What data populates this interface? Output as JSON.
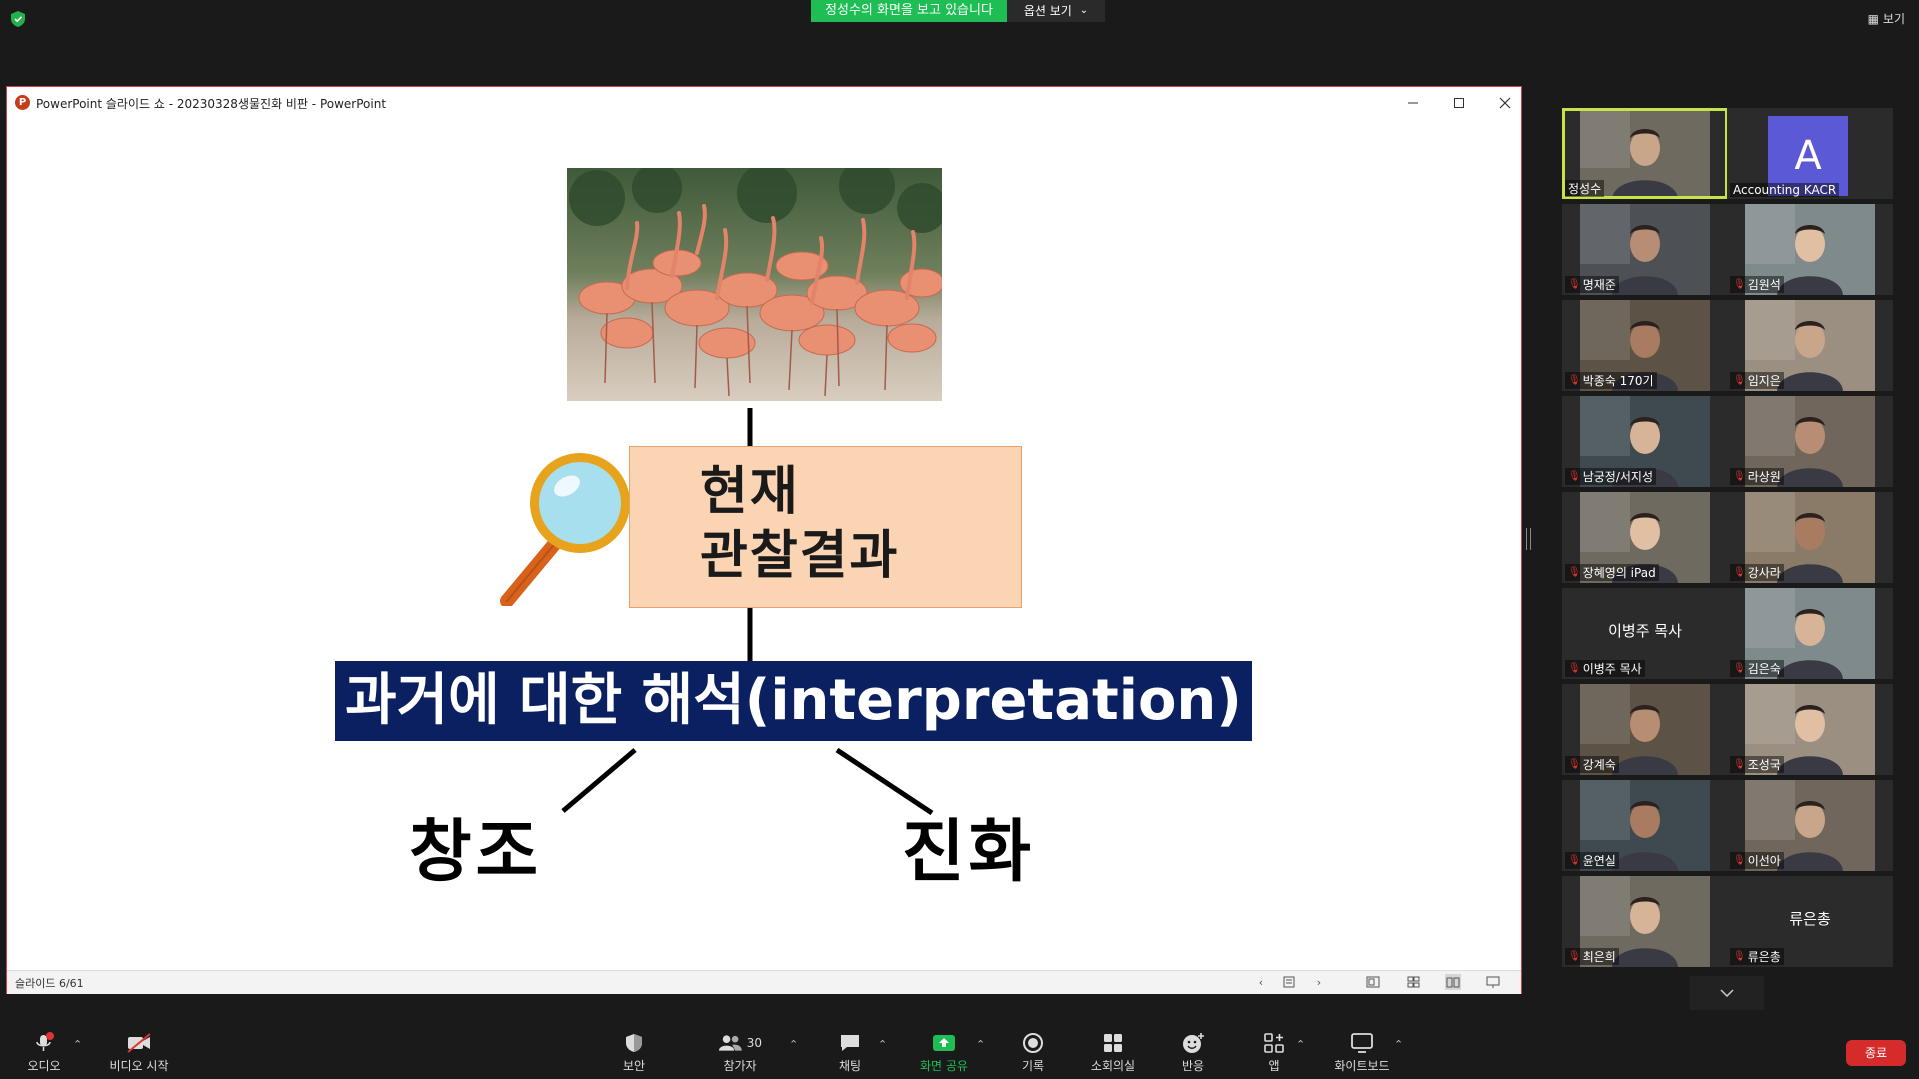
{
  "topbar": {
    "share_banner": "정성수의 화면을 보고 있습니다",
    "view_options": "옵션 보기",
    "view_toggle": "보기"
  },
  "ppt": {
    "title": "PowerPoint 슬라이드 쇼  -  20230328생물진화 비판 - PowerPoint",
    "slide_counter": "슬라이드 6/61"
  },
  "slide": {
    "observation_line1": "현재",
    "observation_line2": "관찰결과",
    "interpretation": "과거에 대한 해석(interpretation)",
    "creation": "창조",
    "evolution": "진화"
  },
  "participants": [
    {
      "name": "정성수",
      "muted": false,
      "type": "video",
      "active": true
    },
    {
      "name": "Accounting KACR",
      "muted": false,
      "type": "avatar",
      "initial": "A"
    },
    {
      "name": "명재준",
      "muted": true,
      "type": "video"
    },
    {
      "name": "김원석",
      "muted": true,
      "type": "video"
    },
    {
      "name": "박종숙 170기",
      "muted": true,
      "type": "video"
    },
    {
      "name": "임지은",
      "muted": true,
      "type": "video"
    },
    {
      "name": "남궁정/서지성",
      "muted": true,
      "type": "video"
    },
    {
      "name": "라상원",
      "muted": true,
      "type": "video"
    },
    {
      "name": "장혜영의 iPad",
      "muted": true,
      "type": "video"
    },
    {
      "name": "강사라",
      "muted": true,
      "type": "video"
    },
    {
      "name": "이병주 목사",
      "muted": true,
      "type": "name",
      "center": "이병주 목사"
    },
    {
      "name": "김은숙",
      "muted": true,
      "type": "video"
    },
    {
      "name": "강계숙",
      "muted": true,
      "type": "video"
    },
    {
      "name": "조성국",
      "muted": true,
      "type": "video"
    },
    {
      "name": "윤연실",
      "muted": true,
      "type": "video"
    },
    {
      "name": "이선아",
      "muted": true,
      "type": "video"
    },
    {
      "name": "최은희",
      "muted": true,
      "type": "video"
    },
    {
      "name": "류은총",
      "muted": true,
      "type": "name",
      "center": "류은총"
    }
  ],
  "toolbar": {
    "audio": "오디오",
    "video": "비디오 시작",
    "security": "보안",
    "participants": "참가자",
    "participants_count": "30",
    "chat": "채팅",
    "share": "화면 공유",
    "record": "기록",
    "breakout": "소회의실",
    "reactions": "반응",
    "apps": "앱",
    "whiteboard": "화이트보드",
    "end": "종료"
  },
  "colors": {
    "share_green": "#1fbe55",
    "slide_navy": "#0a2060",
    "observation_peach": "#fbd4b4",
    "end_red": "#d52b2b",
    "active_speaker": "#c6e34a"
  }
}
